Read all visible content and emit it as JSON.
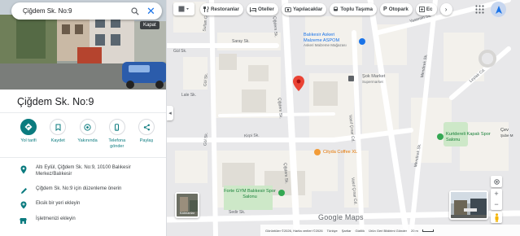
{
  "search": {
    "value": "Çiğdem Sk. No:9",
    "close_tooltip": "Kapat"
  },
  "place": {
    "title": "Çiğdem Sk. No:9"
  },
  "actions": [
    {
      "label": "Yol tarifi",
      "icon": "directions-icon"
    },
    {
      "label": "Kaydet",
      "icon": "bookmark-icon"
    },
    {
      "label": "Yakınında",
      "icon": "nearby-icon"
    },
    {
      "label": "Telefona gönder",
      "icon": "phone-icon"
    },
    {
      "label": "Paylaş",
      "icon": "share-icon"
    }
  ],
  "info": {
    "address": "Altı Eylül, Çiğdem Sk. No:9, 10100 Balıkesir Merkez/Balıkesir",
    "suggest_edit": "Çiğdem Sk. No:9 için düzenleme önerin",
    "add_missing": "Eksik bir yeri ekleyin",
    "add_business": "İşletmenizi ekleyin"
  },
  "chips": [
    {
      "label": "Restoranlar",
      "icon": "restaurant-icon"
    },
    {
      "label": "Oteller",
      "icon": "hotel-icon"
    },
    {
      "label": "Yapılacaklar",
      "icon": "camera-icon"
    },
    {
      "label": "Toplu Taşıma",
      "icon": "transit-icon"
    },
    {
      "label": "Otopark",
      "icon": "parking-icon"
    },
    {
      "label": "Ec",
      "icon": "pharmacy-icon"
    }
  ],
  "map": {
    "pois": [
      {
        "name": "Balıkesir Askeri Malzeme ASPOM",
        "sub": "Askeri Malzeme Mağazası"
      },
      {
        "name": "Şok Market",
        "sub": "Supermarket"
      },
      {
        "name": "Cityda Coffee XL"
      },
      {
        "name": "Forte GYM Balıkesir Spor Salonu"
      },
      {
        "name": "Kurtdereli Kapalı Spor Salonu"
      },
      {
        "name": "Çev",
        "sub": "Şube M"
      }
    ],
    "streets": {
      "saray": "Saray Sk.",
      "kirpi": "Kirpi Sk.",
      "cigdem_top": "Çiğdem Sk.",
      "cigdem_mid": "Çiğdem Sk.",
      "cigdem_low": "Çiğdem Sk.",
      "gol": "Göl Sk.",
      "gol_left": "Göl Sk.",
      "vasif": "Vasıf Çınar Cd.",
      "vasif2": "Vasıf Çınar Cd.",
      "mendo": "Mendirek Sk.",
      "mendo2": "Mendirek Sk.",
      "yasemin": "Yasemin Sk.",
      "leylak": "Leylak Cd.",
      "sultan": "Sultan Cd.",
      "sok_left1": "Gül Sk.",
      "sok_left2": "Lale Sk.",
      "bottom": "Sedir Sk."
    },
    "thumb_label": "Katmanlar",
    "google": "Google Maps",
    "footer": [
      "Görüntüler ©2026, Harita verileri ©2026",
      "Türkiye",
      "Şartlar",
      "Gizlilik",
      "Ürün Geri Bildirimi Gönder",
      "20 m"
    ]
  },
  "colors": {
    "accent": "#0b7b7f",
    "pin": "#ea4335",
    "park": "#cde8c8",
    "water": "#aadaff"
  }
}
